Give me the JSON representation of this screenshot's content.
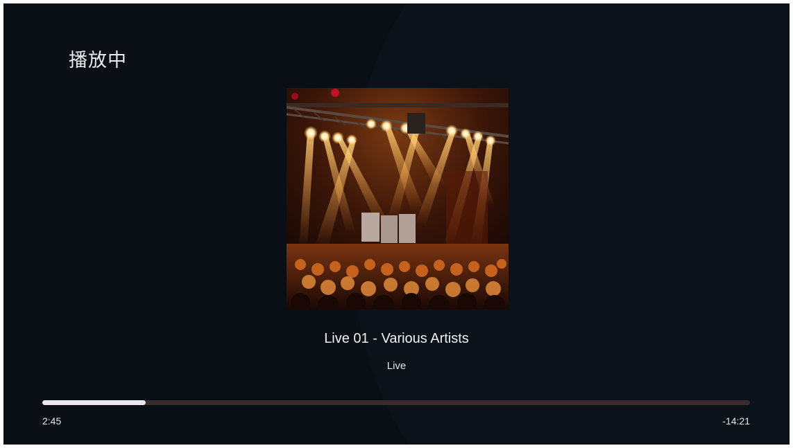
{
  "header": {
    "title": "播放中"
  },
  "now_playing": {
    "track": "Live 01",
    "separator": " - ",
    "artist": "Various Artists",
    "album": "Live",
    "album_art": "concert-stage-lights-photo"
  },
  "playback": {
    "elapsed": "2:45",
    "remaining": "-14:21",
    "progress_fraction": 0.146
  },
  "colors": {
    "background": "#0a0f16",
    "progress_fill": "#e8e8ea",
    "progress_track": "#3a2b2f",
    "text": "#f1f3f5"
  }
}
